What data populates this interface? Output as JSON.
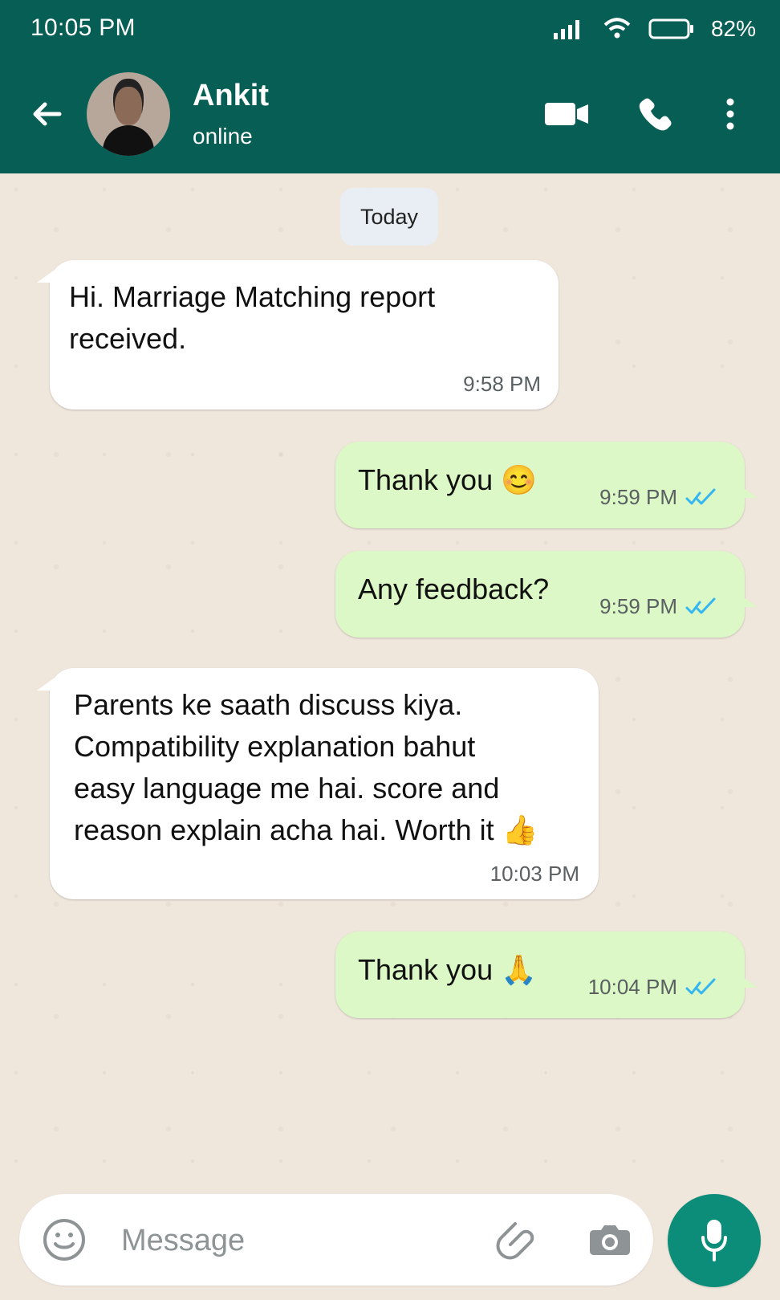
{
  "status_bar": {
    "time": "10:05 PM",
    "battery": "82%"
  },
  "header": {
    "contact_name": "Ankit",
    "contact_status": "online"
  },
  "chat": {
    "date_chip": "Today",
    "messages": [
      {
        "direction": "incoming",
        "text": "Hi. Marriage Matching report\nreceived.",
        "time": "9:58 PM"
      },
      {
        "direction": "outgoing",
        "text": "Thank you 😊",
        "time": "9:59 PM"
      },
      {
        "direction": "outgoing",
        "text": "Any feedback?",
        "time": "9:59 PM"
      },
      {
        "direction": "incoming",
        "text": "Parents ke saath discuss kiya.\nCompatibility explanation bahut\neasy language me hai. score and\nreason explain acha hai. Worth it 👍",
        "time": "10:03 PM"
      },
      {
        "direction": "outgoing",
        "text": "Thank you 🙏",
        "time": "10:04 PM"
      }
    ]
  },
  "composer": {
    "placeholder": "Message"
  },
  "icons": {
    "back": "back-arrow-icon",
    "video": "video-call-icon",
    "call": "phone-icon",
    "menu": "more-vertical-icon",
    "emoji": "emoji-icon",
    "attach": "paperclip-icon",
    "camera": "camera-icon",
    "mic": "mic-icon",
    "read_receipt": "double-check-icon"
  },
  "colors": {
    "header": "#075e54",
    "chat_background": "#efe6dc",
    "incoming_bubble": "#ffffff",
    "outgoing_bubble": "#dcf8c6",
    "read_receipt": "#34b7f1",
    "mic_button": "#0b8d7a"
  }
}
